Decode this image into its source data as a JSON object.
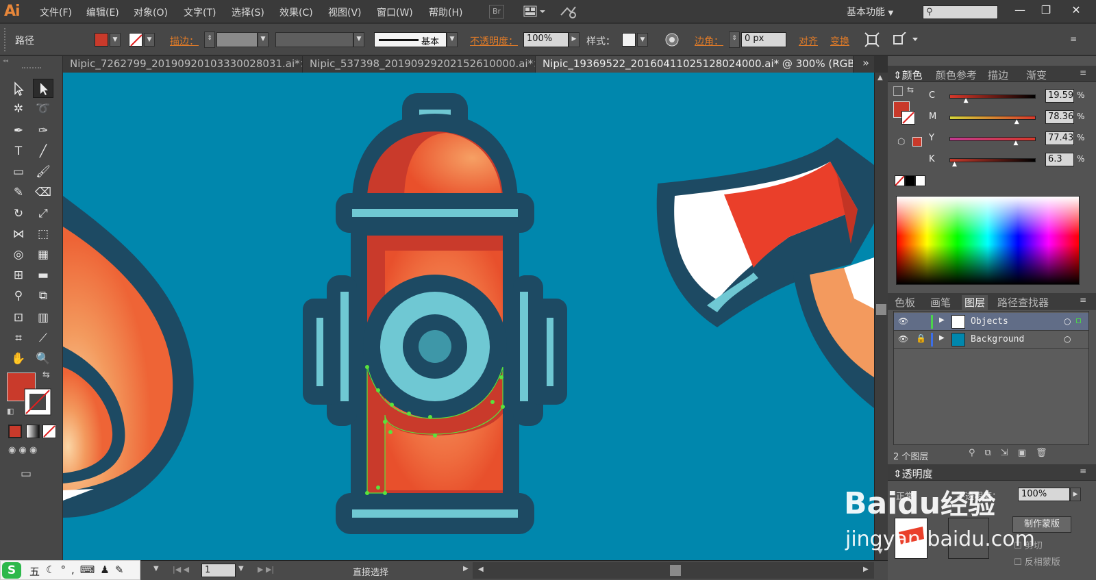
{
  "app": {
    "logo": "Ai",
    "workspace": "基本功能",
    "window_controls": [
      "—",
      "❐",
      "✕"
    ]
  },
  "menu": [
    "文件(F)",
    "编辑(E)",
    "对象(O)",
    "文字(T)",
    "选择(S)",
    "效果(C)",
    "视图(V)",
    "窗口(W)",
    "帮助(H)"
  ],
  "menubar_icons": {
    "bridge": "Br"
  },
  "control": {
    "object_type": "路径",
    "stroke_label": "描边：",
    "stroke_style": "基本",
    "opacity_label": "不透明度：",
    "opacity_value": "100%",
    "style_label": "样式：",
    "corner_label": "边角：",
    "corner_value": "0 px",
    "align_label": "对齐",
    "transform_label": "变换",
    "fill_color": "#c93a2b"
  },
  "tabs": [
    {
      "label": "Nipic_7262799_20190920103330028031.ai*",
      "close": "×"
    },
    {
      "label": "Nipic_537398_20190929202152610000.ai*",
      "close": "×"
    },
    {
      "label": "Nipic_19369522_20160411025128024000.ai* @ 300% (RGB/",
      "close": ""
    }
  ],
  "tabs_overflow": "»",
  "statusbar": {
    "page": "1",
    "tool_name": "直接选择"
  },
  "color_panel": {
    "tabs": [
      "颜色",
      "颜色参考",
      "描边",
      "渐变"
    ],
    "channels": [
      {
        "name": "C",
        "value": "19.59",
        "percent": 19.59,
        "unit": "%"
      },
      {
        "name": "M",
        "value": "78.36",
        "percent": 78.36,
        "unit": "%"
      },
      {
        "name": "Y",
        "value": "77.43",
        "percent": 77.43,
        "unit": "%"
      },
      {
        "name": "K",
        "value": "6.3",
        "percent": 6.3,
        "unit": "%"
      }
    ]
  },
  "layers_panel": {
    "tabs": [
      "色板",
      "画笔",
      "图层",
      "路径查找器"
    ],
    "layers": [
      {
        "name": "Objects",
        "color": "#4cd34c"
      },
      {
        "name": "Background",
        "color": "#3c6ee8"
      }
    ],
    "count": "2 个图层"
  },
  "transparency_panel": {
    "title": "透明度",
    "blend_mode": "正常",
    "opacity_label": "不透明度：",
    "opacity_value": "100%",
    "make_mask": "制作蒙版",
    "clip": "剪切",
    "invert_mask": "反相蒙版"
  },
  "watermark": {
    "brand": "Baidu",
    "brand_cn": "经验",
    "url": "jingyan.baidu.com"
  },
  "ime": {
    "mode": "五"
  },
  "colors": {
    "canvas_bg": "#0087ad",
    "outline": "#1d4a63",
    "red_dark": "#c33424",
    "red_light": "#f08050",
    "teal": "#6fc8d3",
    "selection": "#59e33c"
  }
}
